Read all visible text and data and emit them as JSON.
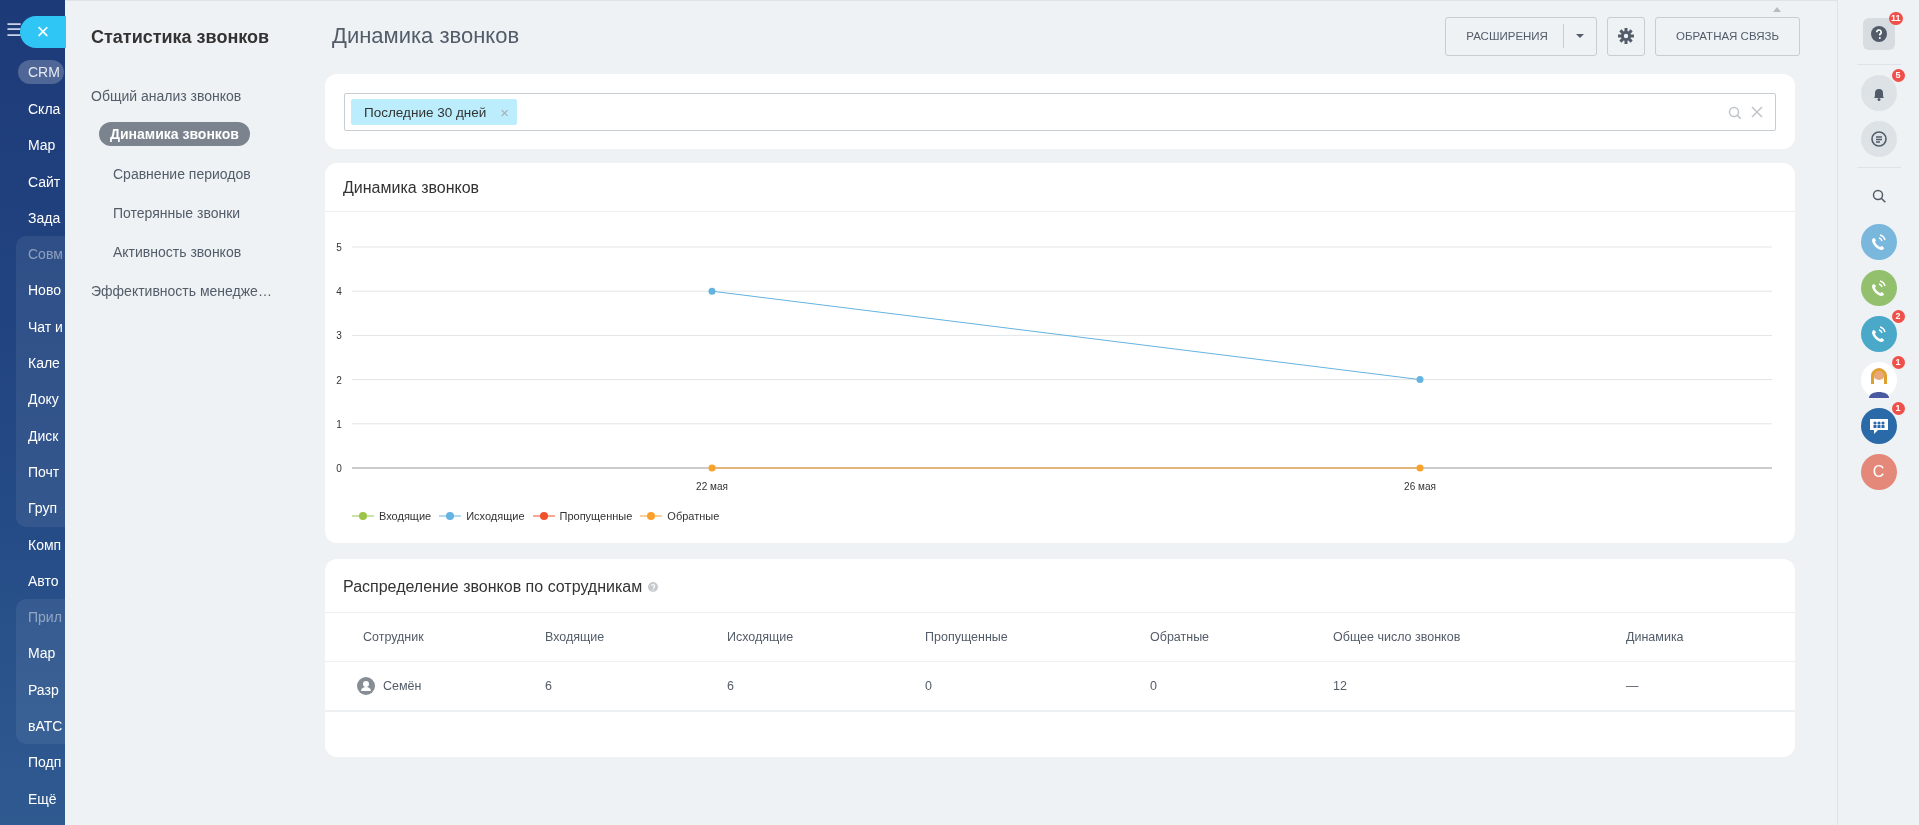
{
  "left_nav": {
    "menu_label": "☰",
    "sections": [
      {
        "kind": "plain",
        "items": [
          {
            "label": "CRM",
            "selected": true
          },
          {
            "label": "Скла",
            "selected": false
          },
          {
            "label": "Мар",
            "selected": false
          },
          {
            "label": "Сайт",
            "selected": false
          },
          {
            "label": "Зада",
            "selected": false
          }
        ]
      },
      {
        "kind": "group",
        "title": "Совм",
        "items": [
          {
            "label": "Ново",
            "selected": false
          },
          {
            "label": "Чат и",
            "selected": false
          },
          {
            "label": "Кале",
            "selected": false
          },
          {
            "label": "Доку",
            "selected": false
          },
          {
            "label": "Диск",
            "selected": false
          },
          {
            "label": "Почт",
            "selected": false
          },
          {
            "label": "Груп",
            "selected": false
          }
        ]
      },
      {
        "kind": "plain",
        "items": [
          {
            "label": "Комп",
            "selected": false
          },
          {
            "label": "Авто",
            "selected": false
          }
        ]
      },
      {
        "kind": "group",
        "title": "Прил",
        "items": [
          {
            "label": "Мар",
            "selected": false
          },
          {
            "label": "Разр",
            "selected": false
          },
          {
            "label": "вАТС",
            "selected": false
          }
        ]
      },
      {
        "kind": "plain",
        "items": [
          {
            "label": "Подп",
            "selected": false
          },
          {
            "label": "Ещё",
            "selected": false
          }
        ]
      }
    ]
  },
  "close_button": {
    "label": "×"
  },
  "report_menu": {
    "title": "Статистика звонков",
    "items": [
      {
        "label": "Общий анализ звонков",
        "selected": false,
        "children": [
          {
            "label": "Динамика звонков",
            "selected": true
          },
          {
            "label": "Сравнение периодов",
            "selected": false
          },
          {
            "label": "Потерянные звонки",
            "selected": false
          },
          {
            "label": "Активность звонков",
            "selected": false
          }
        ]
      },
      {
        "label": "Эффективность менедже…",
        "selected": false
      }
    ]
  },
  "header": {
    "title": "Динамика звонков",
    "buttons": [
      {
        "kind": "split",
        "label": "РАСШИРЕНИЯ"
      },
      {
        "kind": "settings"
      },
      {
        "kind": "text",
        "label": "ОБРАТНАЯ СВЯЗЬ"
      }
    ]
  },
  "filter": {
    "chips": [
      {
        "label": "Последние 30 дней",
        "remove": "×"
      }
    ]
  },
  "chart": {
    "title": "Динамика звонков",
    "chart_data": {
      "type": "line",
      "grid": true,
      "legend": "bottom-left",
      "categories": [
        "22 мая",
        "26 мая"
      ],
      "ylim": [
        0,
        5
      ],
      "yticks": [
        0,
        1,
        2,
        3,
        4,
        5
      ],
      "series": [
        {
          "name": "Входящие",
          "color": "#9cc34a",
          "marker": "circle",
          "values": [
            null,
            null
          ]
        },
        {
          "name": "Исходящие",
          "color": "#64b3e0",
          "marker": "circle",
          "values": [
            4,
            2
          ]
        },
        {
          "name": "Пропущенные",
          "color": "#f0502a",
          "marker": "circle",
          "values": [
            null,
            null
          ]
        },
        {
          "name": "Обратные",
          "color": "#f9a12b",
          "marker": "circle",
          "values": [
            0,
            0
          ]
        }
      ]
    }
  },
  "table": {
    "title": "Распределение звонков по сотрудникам",
    "columns": [
      "Сотрудник",
      "Входящие",
      "Исходящие",
      "Пропущенные",
      "Обратные",
      "Общее число звонков",
      "Динамика"
    ],
    "rows": [
      {
        "cells": [
          "Семён",
          "6",
          "6",
          "0",
          "0",
          "12",
          "—"
        ]
      }
    ]
  },
  "right_bar": {
    "items": [
      {
        "kind": "help",
        "badge": "11"
      },
      {
        "kind": "notifications",
        "badge": "5"
      },
      {
        "kind": "chat"
      },
      {
        "kind": "search"
      },
      {
        "kind": "call",
        "color": "#79b8dc"
      },
      {
        "kind": "call",
        "color": "#93c06d"
      },
      {
        "kind": "call",
        "color": "#4aa8c8",
        "badge": "2"
      },
      {
        "kind": "user",
        "badge": "1"
      },
      {
        "kind": "group_chat",
        "badge": "1"
      },
      {
        "kind": "initial",
        "label": "С",
        "color": "#e4897a"
      }
    ]
  }
}
